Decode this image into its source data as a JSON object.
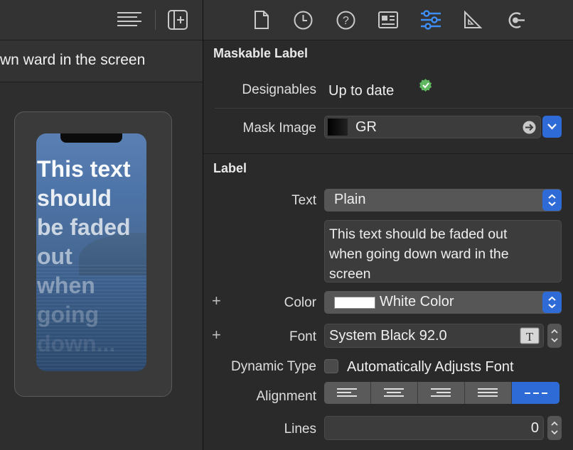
{
  "left_panel": {
    "title_fragment": "wn ward in the screen",
    "preview_lines": [
      "This text",
      "should",
      "be faded",
      "out",
      "when",
      "going",
      "down..."
    ]
  },
  "inspector": {
    "maskable_label": {
      "section_title": "Maskable Label",
      "designables_label": "Designables",
      "designables_value": "Up to date",
      "mask_image_label": "Mask Image",
      "mask_image_value": "GR"
    },
    "label": {
      "section_title": "Label",
      "text_label": "Text",
      "text_type": "Plain",
      "text_value": "This text should be faded out when going down ward in the screen",
      "text_lines": [
        "This text should be faded out",
        "when going down ward in the",
        "screen"
      ],
      "color_label": "Color",
      "color_value": "White Color",
      "font_label": "Font",
      "font_value": "System Black 92.0",
      "dynamic_type_label": "Dynamic Type",
      "dynamic_type_checkbox": "Automatically Adjusts Font",
      "alignment_label": "Alignment",
      "alignment_options": [
        "left",
        "center",
        "right",
        "justified",
        "natural"
      ],
      "alignment_selected": "natural",
      "lines_label": "Lines",
      "lines_value": "0"
    }
  },
  "colors": {
    "accent": "#2e6bd6",
    "status_ok": "#5fb75f",
    "swatch": "#ffffff"
  },
  "icons": [
    "list-lines-icon",
    "add-editor-icon",
    "file-icon",
    "history-clock-icon",
    "help-icon",
    "identity-card-icon",
    "attributes-sliders-icon",
    "ruler-icon",
    "connections-icon",
    "checkmark-badge-icon",
    "arrow-circle-icon",
    "chevron-down-icon",
    "text-font-icon",
    "plus-icon"
  ]
}
